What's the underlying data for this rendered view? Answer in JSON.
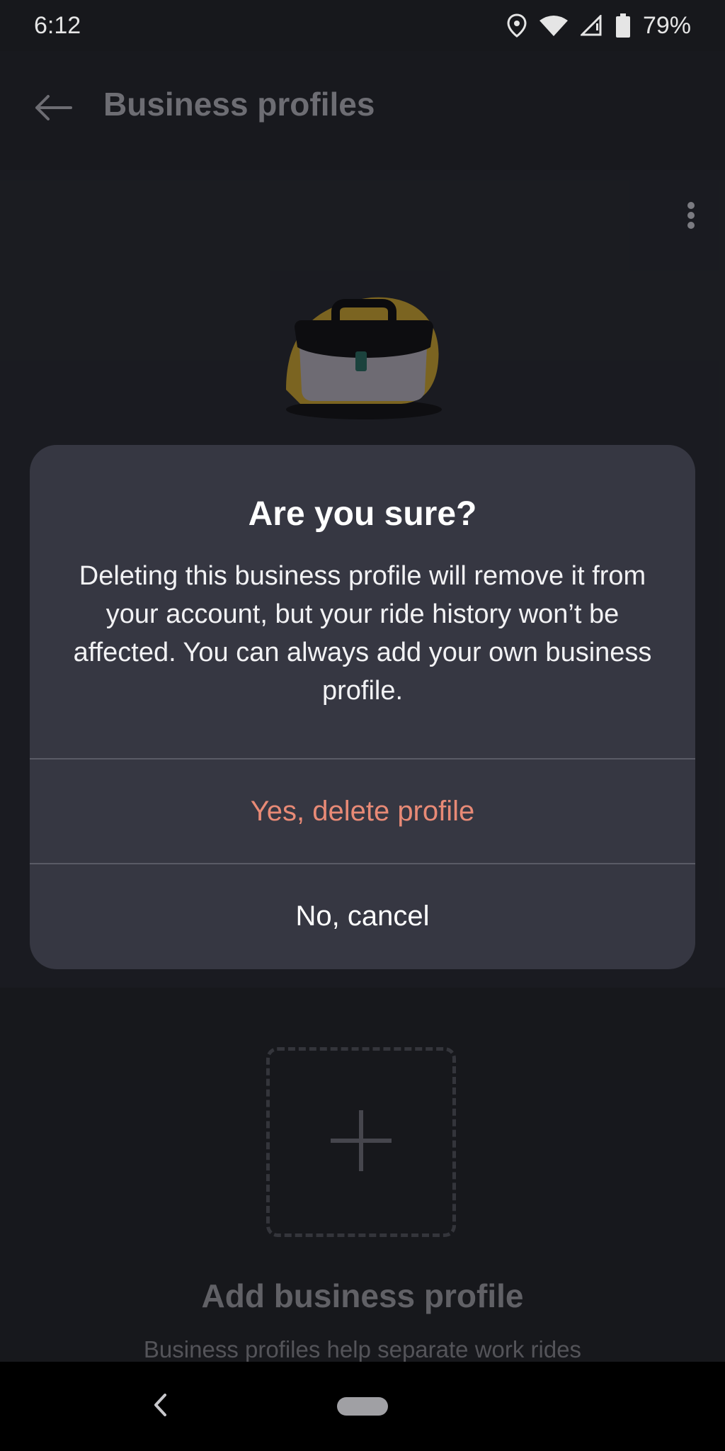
{
  "status_bar": {
    "time": "6:12",
    "battery": "79%",
    "icons": [
      "location-icon",
      "wifi-icon",
      "signal-icon",
      "battery-icon"
    ]
  },
  "app_bar": {
    "title": "Business profiles",
    "back_icon": "arrow-left-icon",
    "more_icon": "more-vert-icon"
  },
  "profile_card": {
    "illustration": "briefcase-icon"
  },
  "add_section": {
    "title": "Add business profile",
    "description": "Business profiles help separate work rides",
    "icon": "plus-icon"
  },
  "dialog": {
    "title": "Are you sure?",
    "body": "Deleting this business profile will remove it from your account, but your ride history won’t be affected. You can always add your own business profile.",
    "confirm_label": "Yes, delete profile",
    "cancel_label": "No, cancel"
  },
  "nav_bar": {
    "back_icon": "chevron-left-icon",
    "home_icon": "home-pill-icon"
  },
  "colors": {
    "background": "#1a1b20",
    "dialog": "#363742",
    "destructive": "#e88a76",
    "illustration_accent": "#8a7025"
  }
}
